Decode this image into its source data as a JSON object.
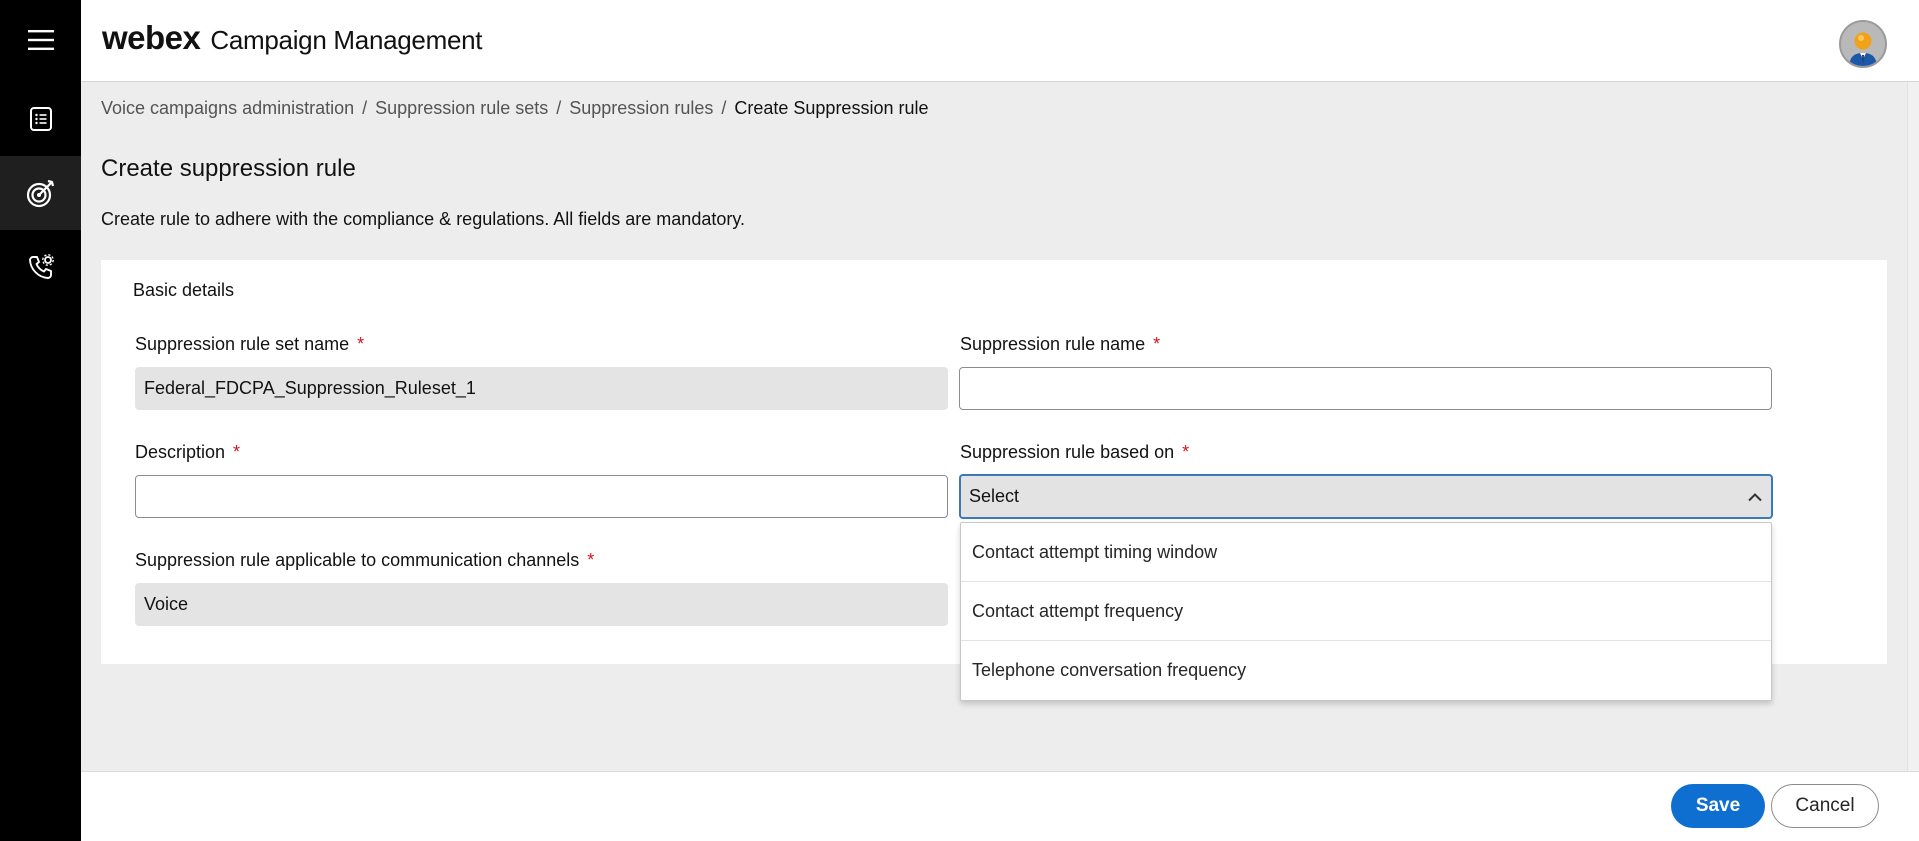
{
  "app": {
    "brand": "webex",
    "name": "Campaign Management"
  },
  "rail": {
    "items": [
      {
        "icon": "menu-icon"
      },
      {
        "icon": "list-document-icon"
      },
      {
        "icon": "target-icon",
        "active": true
      },
      {
        "icon": "phone-settings-icon"
      }
    ]
  },
  "breadcrumb": [
    "Voice campaigns administration",
    "Suppression rule sets",
    "Suppression rules",
    "Create Suppression rule"
  ],
  "breadcrumb_separator": "/",
  "page": {
    "title": "Create suppression rule",
    "description": "Create rule to adhere with the compliance & regulations. All fields are mandatory."
  },
  "form": {
    "section_title": "Basic details",
    "required_marker": "*",
    "rule_set_name": {
      "label": "Suppression rule set name",
      "value": "Federal_FDCPA_Suppression_Ruleset_1"
    },
    "rule_name": {
      "label": "Suppression rule name",
      "value": ""
    },
    "description": {
      "label": "Description",
      "value": ""
    },
    "based_on": {
      "label": "Suppression rule based on",
      "selected": "Select",
      "options": [
        "Contact attempt timing window",
        "Contact attempt frequency",
        "Telephone conversation frequency"
      ]
    },
    "channels": {
      "label": "Suppression rule applicable to communication channels",
      "value": "Voice"
    }
  },
  "footer": {
    "save_label": "Save",
    "cancel_label": "Cancel"
  },
  "colors": {
    "primary": "#0f6fd1",
    "required": "#d4151c",
    "rail_bg": "#000000",
    "focus_border": "#3a7ab8"
  }
}
